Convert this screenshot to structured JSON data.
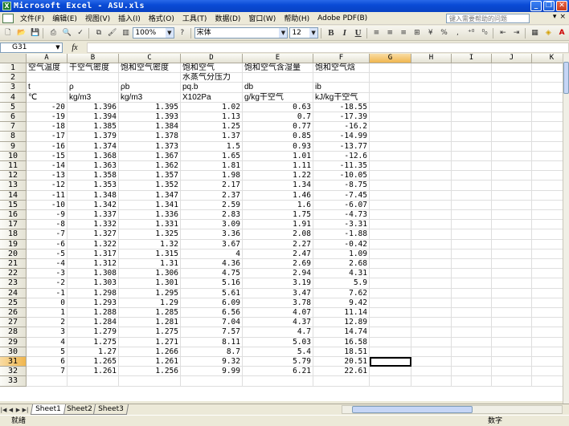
{
  "window": {
    "title": "Microsoft Excel - ASU.xls",
    "controls": [
      "_",
      "❐",
      "✕"
    ]
  },
  "menu": {
    "items": [
      "文件(F)",
      "编辑(E)",
      "视图(V)",
      "插入(I)",
      "格式(O)",
      "工具(T)",
      "数据(D)",
      "窗口(W)",
      "帮助(H)",
      "Adobe PDF(B)"
    ],
    "help_placeholder": "键入需要帮助的问题",
    "right_controls": [
      "▾",
      "×"
    ]
  },
  "toolbar": {
    "zoom": "100%",
    "font": "宋体",
    "font_size": "12",
    "bold": "B",
    "italic": "I",
    "underline": "U",
    "percent": "%"
  },
  "formula_bar": {
    "name_box": "G31",
    "fx": "fx",
    "content": ""
  },
  "columns": [
    "A",
    "B",
    "C",
    "D",
    "E",
    "F",
    "G",
    "H",
    "I",
    "J",
    "K"
  ],
  "selected_column": "G",
  "selected_row": "31",
  "header_rows": [
    [
      "空气温度",
      "干空气密度",
      "饱和空气密度",
      "饱和空气",
      "饱和空气含湿量",
      "饱和空气焓"
    ],
    [
      "",
      "",
      "",
      "水蒸气分压力",
      "",
      ""
    ],
    [
      "t",
      "ρ",
      "ρb",
      "pq.b",
      "db",
      "ib"
    ],
    [
      "℃",
      "kg/m3",
      "kg/m3",
      "X102Pa",
      "g/kg干空气",
      "kJ/kg干空气"
    ]
  ],
  "data_rows": [
    [
      "-20",
      "1.396",
      "1.395",
      "1.02",
      "0.63",
      "-18.55"
    ],
    [
      "-19",
      "1.394",
      "1.393",
      "1.13",
      "0.7",
      "-17.39"
    ],
    [
      "-18",
      "1.385",
      "1.384",
      "1.25",
      "0.77",
      "-16.2"
    ],
    [
      "-17",
      "1.379",
      "1.378",
      "1.37",
      "0.85",
      "-14.99"
    ],
    [
      "-16",
      "1.374",
      "1.373",
      "1.5",
      "0.93",
      "-13.77"
    ],
    [
      "-15",
      "1.368",
      "1.367",
      "1.65",
      "1.01",
      "-12.6"
    ],
    [
      "-14",
      "1.363",
      "1.362",
      "1.81",
      "1.11",
      "-11.35"
    ],
    [
      "-13",
      "1.358",
      "1.357",
      "1.98",
      "1.22",
      "-10.05"
    ],
    [
      "-12",
      "1.353",
      "1.352",
      "2.17",
      "1.34",
      "-8.75"
    ],
    [
      "-11",
      "1.348",
      "1.347",
      "2.37",
      "1.46",
      "-7.45"
    ],
    [
      "-10",
      "1.342",
      "1.341",
      "2.59",
      "1.6",
      "-6.07"
    ],
    [
      "-9",
      "1.337",
      "1.336",
      "2.83",
      "1.75",
      "-4.73"
    ],
    [
      "-8",
      "1.332",
      "1.331",
      "3.09",
      "1.91",
      "-3.31"
    ],
    [
      "-7",
      "1.327",
      "1.325",
      "3.36",
      "2.08",
      "-1.88"
    ],
    [
      "-6",
      "1.322",
      "1.32",
      "3.67",
      "2.27",
      "-0.42"
    ],
    [
      "-5",
      "1.317",
      "1.315",
      "4",
      "2.47",
      "1.09"
    ],
    [
      "-4",
      "1.312",
      "1.31",
      "4.36",
      "2.69",
      "2.68"
    ],
    [
      "-3",
      "1.308",
      "1.306",
      "4.75",
      "2.94",
      "4.31"
    ],
    [
      "-2",
      "1.303",
      "1.301",
      "5.16",
      "3.19",
      "5.9"
    ],
    [
      "-1",
      "1.298",
      "1.295",
      "5.61",
      "3.47",
      "7.62"
    ],
    [
      "0",
      "1.293",
      "1.29",
      "6.09",
      "3.78",
      "9.42"
    ],
    [
      "1",
      "1.288",
      "1.285",
      "6.56",
      "4.07",
      "11.14"
    ],
    [
      "2",
      "1.284",
      "1.281",
      "7.04",
      "4.37",
      "12.89"
    ],
    [
      "3",
      "1.279",
      "1.275",
      "7.57",
      "4.7",
      "14.74"
    ],
    [
      "4",
      "1.275",
      "1.271",
      "8.11",
      "5.03",
      "16.58"
    ],
    [
      "5",
      "1.27",
      "1.266",
      "8.7",
      "5.4",
      "18.51"
    ],
    [
      "6",
      "1.265",
      "1.261",
      "9.32",
      "5.79",
      "20.51"
    ],
    [
      "7",
      "1.261",
      "1.256",
      "9.99",
      "6.21",
      "22.61"
    ]
  ],
  "sheets": [
    "Sheet1",
    "Sheet2",
    "Sheet3"
  ],
  "active_sheet": "Sheet1",
  "status": {
    "left": "就绪",
    "mode": "数字"
  },
  "colors": {
    "titlebar": "#0a4bd6",
    "selection": "#f0b64e",
    "gridline": "#dedede"
  }
}
